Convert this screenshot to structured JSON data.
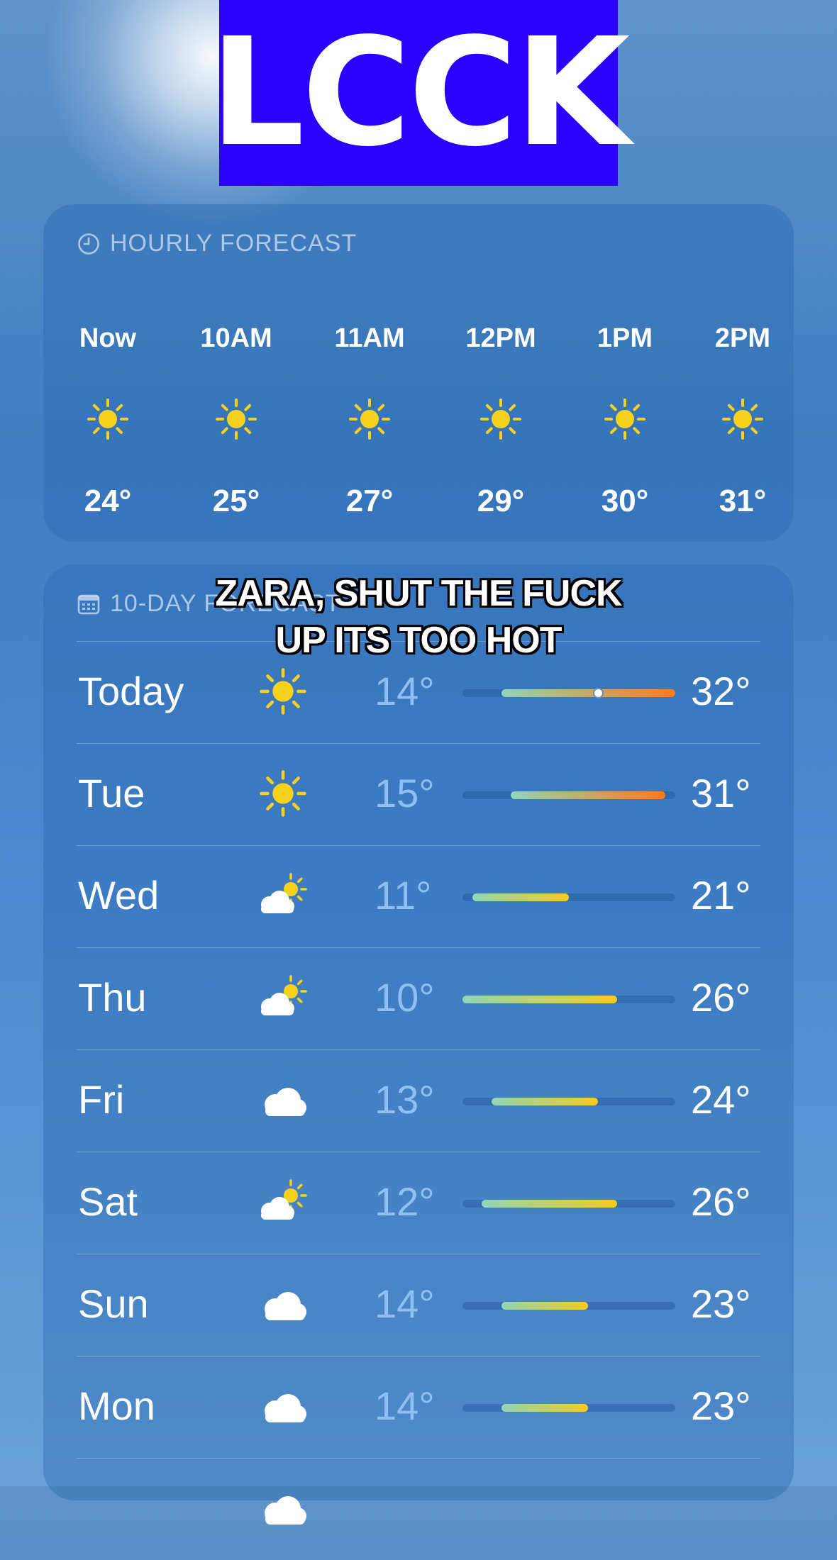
{
  "banner": {
    "text": "LCCK"
  },
  "caption": {
    "line1": "ZARA, SHUT THE FUCK",
    "line2": "UP ITS TOO HOT"
  },
  "hourly": {
    "title": "HOURLY FORECAST",
    "header_icon": "clock-icon",
    "hours": [
      {
        "label": "Now",
        "icon": "sun-icon",
        "temp": "24°"
      },
      {
        "label": "10AM",
        "icon": "sun-icon",
        "temp": "25°"
      },
      {
        "label": "11AM",
        "icon": "sun-icon",
        "temp": "27°"
      },
      {
        "label": "12PM",
        "icon": "sun-icon",
        "temp": "29°"
      },
      {
        "label": "1PM",
        "icon": "sun-icon",
        "temp": "30°"
      },
      {
        "label": "2PM",
        "icon": "sun-icon",
        "temp": "31°"
      }
    ]
  },
  "daily": {
    "title": "10-DAY FORECAST",
    "header_icon": "calendar-icon",
    "range_min": 10,
    "range_max": 32,
    "days": [
      {
        "day": "Today",
        "icon": "sun-icon",
        "low": "14°",
        "high": "32°",
        "low_val": 14,
        "high_val": 32,
        "current_val": 24
      },
      {
        "day": "Tue",
        "icon": "sun-icon",
        "low": "15°",
        "high": "31°",
        "low_val": 15,
        "high_val": 31
      },
      {
        "day": "Wed",
        "icon": "partly-cloudy-icon",
        "low": "11°",
        "high": "21°",
        "low_val": 11,
        "high_val": 21
      },
      {
        "day": "Thu",
        "icon": "partly-cloudy-icon",
        "low": "10°",
        "high": "26°",
        "low_val": 10,
        "high_val": 26
      },
      {
        "day": "Fri",
        "icon": "cloud-icon",
        "low": "13°",
        "high": "24°",
        "low_val": 13,
        "high_val": 24
      },
      {
        "day": "Sat",
        "icon": "partly-cloudy-icon",
        "low": "12°",
        "high": "26°",
        "low_val": 12,
        "high_val": 26
      },
      {
        "day": "Sun",
        "icon": "cloud-icon",
        "low": "14°",
        "high": "23°",
        "low_val": 14,
        "high_val": 23
      },
      {
        "day": "Mon",
        "icon": "cloud-icon",
        "low": "14°",
        "high": "23°",
        "low_val": 14,
        "high_val": 23
      }
    ]
  },
  "colors": {
    "banner_bg": "#2a00ff",
    "sun_yellow": "#f7d21c",
    "cool_green": "#8fd6b8",
    "warm_yellow": "#f5cc1e",
    "hot_orange": "#ff7a1a"
  }
}
